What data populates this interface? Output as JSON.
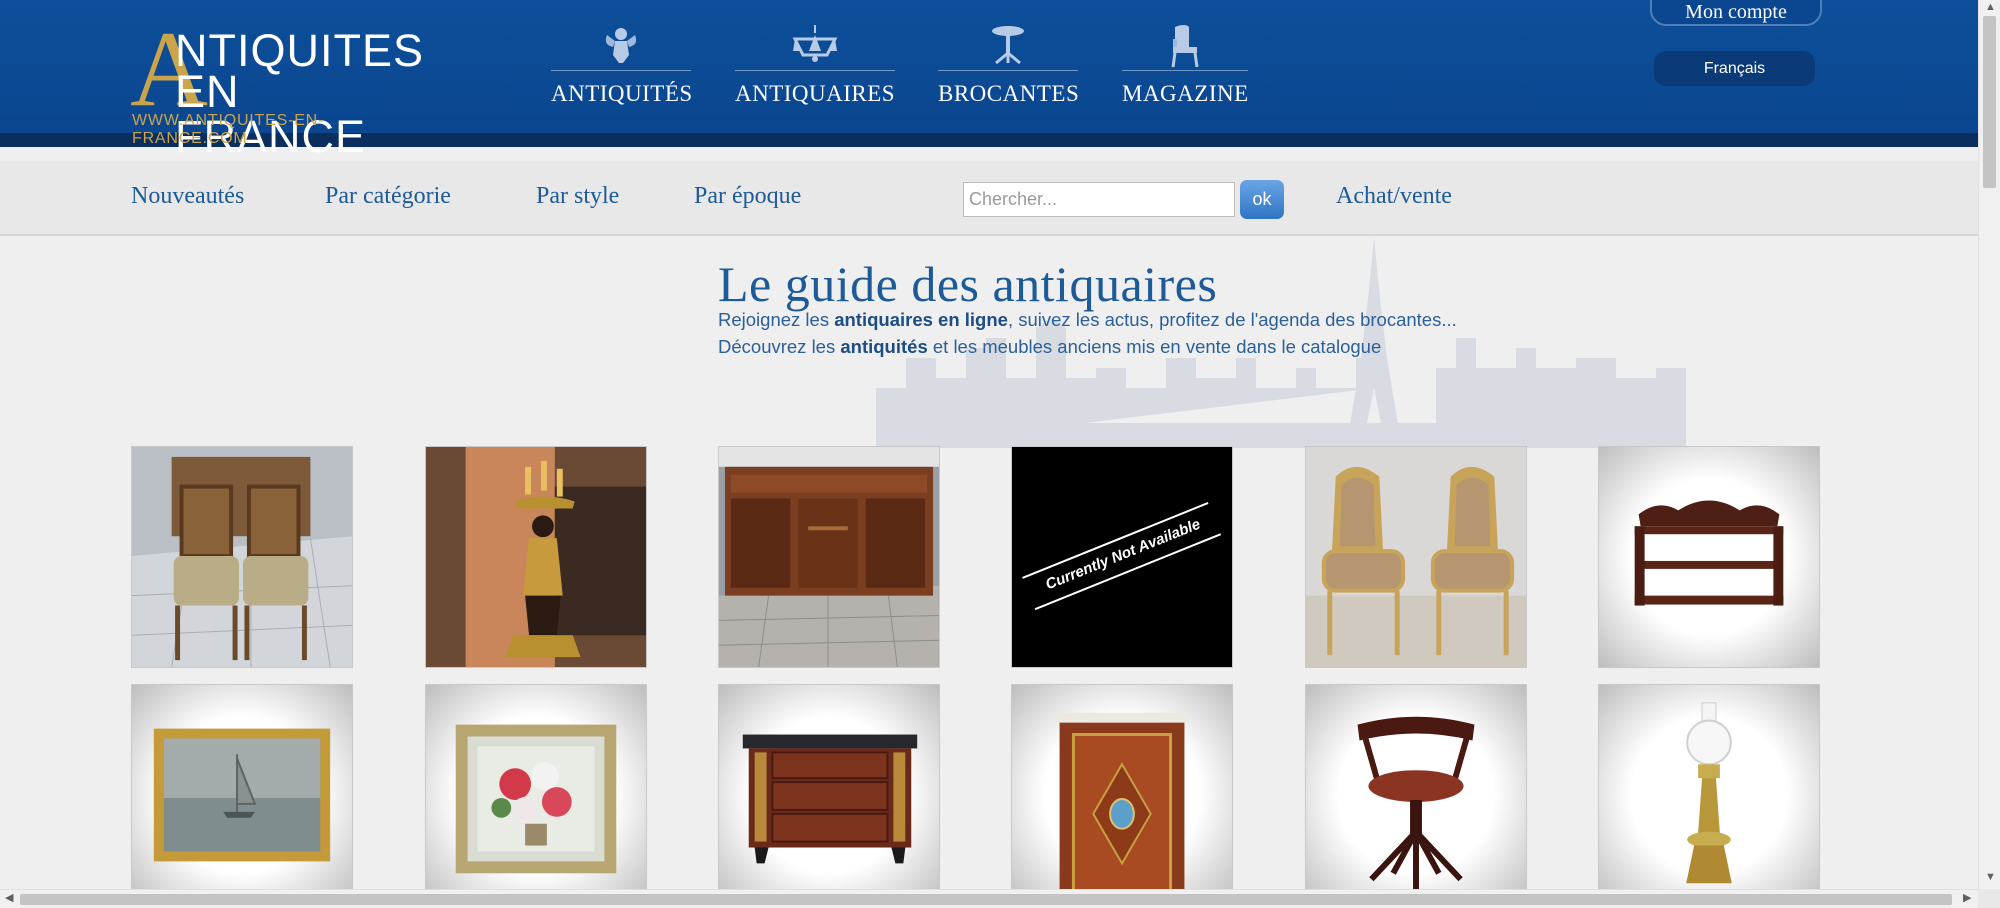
{
  "header": {
    "logo": {
      "big_letter": "A",
      "line1": "NTIQUITES",
      "line2": "EN FRANCE",
      "url": "WWW.ANTIQUITES-EN-FRANCE.COM"
    },
    "nav": [
      {
        "label": "ANTIQUITÉS",
        "icon": "cherub-icon"
      },
      {
        "label": "ANTIQUAIRES",
        "icon": "chandelier-icon"
      },
      {
        "label": "BROCANTES",
        "icon": "pedestal-table-icon"
      },
      {
        "label": "MAGAZINE",
        "icon": "armchair-icon"
      }
    ],
    "account_label": "Mon compte",
    "language_label": "Français"
  },
  "subnav": {
    "links": [
      "Nouveautés",
      "Par catégorie",
      "Par style",
      "Par époque"
    ],
    "search_placeholder": "Chercher...",
    "search_button": "ok",
    "achat_vente": "Achat/vente"
  },
  "hero": {
    "title": "Le guide des antiquaires",
    "line1_pre": "Rejoignez les ",
    "line1_bold": "antiquaires en ligne",
    "line1_post": ", suivez les actus, profitez de l'agenda des brocantes...",
    "line2_pre": "Découvrez les ",
    "line2_bold": "antiquités",
    "line2_post": " et les meubles anciens mis en vente dans le catalogue"
  },
  "products": [
    {
      "name": "pair-of-chairs"
    },
    {
      "name": "blackamoor-candelabra"
    },
    {
      "name": "mahogany-sideboard"
    },
    {
      "name": "unavailable",
      "overlay_text": "Currently Not Available"
    },
    {
      "name": "pair-of-armchairs"
    },
    {
      "name": "wall-shelf"
    },
    {
      "name": "seascape-painting"
    },
    {
      "name": "flower-painting"
    },
    {
      "name": "empire-commode"
    },
    {
      "name": "marquetry-cabinet"
    },
    {
      "name": "swivel-office-chair"
    },
    {
      "name": "oil-lamp"
    }
  ],
  "colors": {
    "header_blue": "#0b4690",
    "link_blue": "#1d5a98",
    "logo_gold": "#c9a44b"
  }
}
